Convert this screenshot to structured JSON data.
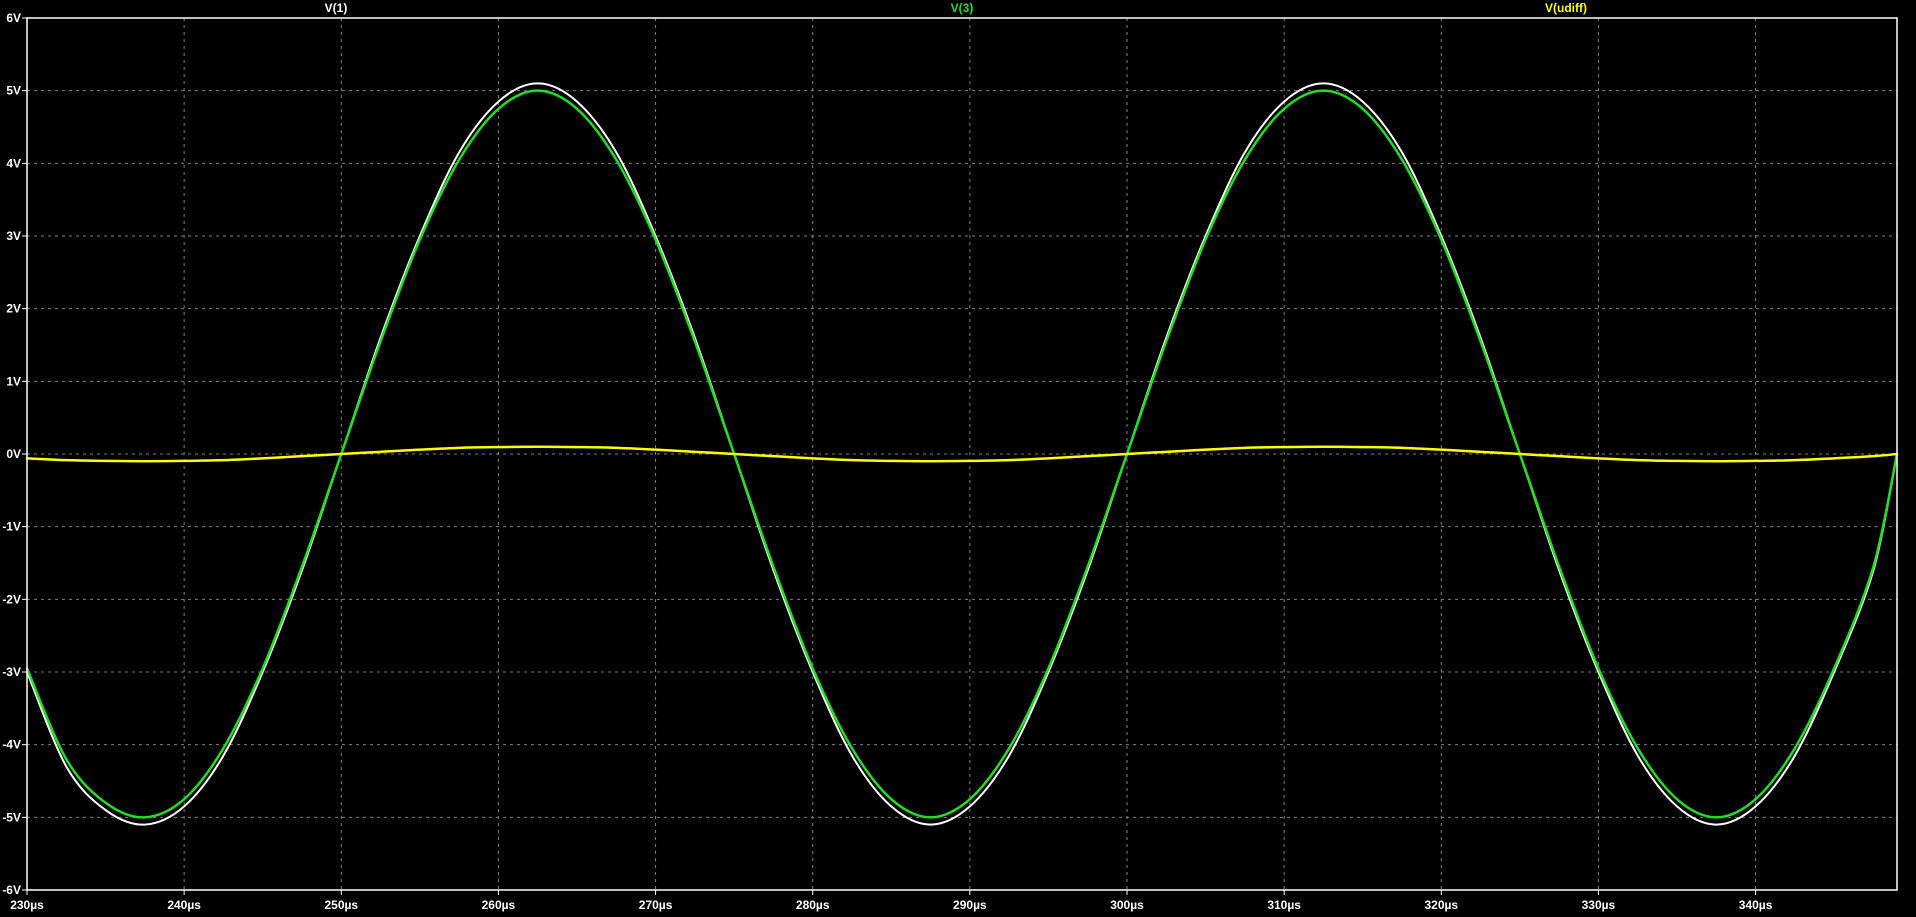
{
  "chart_data": {
    "type": "line",
    "title": "",
    "xlabel": "",
    "ylabel": "",
    "xlim": [
      230,
      349
    ],
    "ylim": [
      -6,
      6
    ],
    "x_unit": "µs",
    "y_unit": "V",
    "grid": true,
    "background": "#000000",
    "axis_color": "#ffffff",
    "grid_color": "#808080",
    "x_ticks": [
      "230µs",
      "240µs",
      "250µs",
      "260µs",
      "270µs",
      "280µs",
      "290µs",
      "300µs",
      "310µs",
      "320µs",
      "330µs",
      "340µs"
    ],
    "x_tick_values": [
      230,
      240,
      250,
      260,
      270,
      280,
      290,
      300,
      310,
      320,
      330,
      340
    ],
    "y_ticks": [
      "6V",
      "5V",
      "4V",
      "3V",
      "2V",
      "1V",
      "0V",
      "-1V",
      "-2V",
      "-3V",
      "-4V",
      "-5V",
      "-6V"
    ],
    "y_tick_values": [
      6,
      5,
      4,
      3,
      2,
      1,
      0,
      -1,
      -2,
      -3,
      -4,
      -5,
      -6
    ],
    "series": [
      {
        "name": "V(1)",
        "color": "#ffffff",
        "x": [
          230,
          232.5,
          235,
          237.5,
          240,
          242.5,
          245,
          247.5,
          250,
          252.5,
          255,
          257.5,
          260,
          262.5,
          265,
          267.5,
          270,
          272.5,
          275,
          277.5,
          280,
          282.5,
          285,
          287.5,
          290,
          292.5,
          295,
          297.5,
          300,
          302.5,
          305,
          307.5,
          310,
          312.5,
          315,
          317.5,
          320,
          322.5,
          325,
          327.5,
          330,
          332.5,
          335,
          337.5,
          340,
          342.5,
          345,
          347.5,
          349
        ],
        "y": [
          -3.0,
          -4.3,
          -4.9,
          -5.1,
          -4.85,
          -4.15,
          -3.0,
          -1.6,
          0.0,
          1.6,
          3.0,
          4.15,
          4.85,
          5.1,
          4.85,
          4.15,
          3.0,
          1.6,
          0.0,
          -1.6,
          -3.0,
          -4.15,
          -4.85,
          -5.1,
          -4.85,
          -4.15,
          -3.0,
          -1.6,
          0.0,
          1.6,
          3.0,
          4.15,
          4.85,
          5.1,
          4.85,
          4.15,
          3.0,
          1.6,
          0.0,
          -1.6,
          -3.0,
          -4.15,
          -4.85,
          -5.1,
          -4.85,
          -4.15,
          -3.0,
          -1.6,
          0.0
        ]
      },
      {
        "name": "V(3)",
        "color": "#22dd22",
        "x": [
          230,
          232.5,
          235,
          237.5,
          240,
          242.5,
          245,
          247.5,
          250,
          252.5,
          255,
          257.5,
          260,
          262.5,
          265,
          267.5,
          270,
          272.5,
          275,
          277.5,
          280,
          282.5,
          285,
          287.5,
          290,
          292.5,
          295,
          297.5,
          300,
          302.5,
          305,
          307.5,
          310,
          312.5,
          315,
          317.5,
          320,
          322.5,
          325,
          327.5,
          330,
          332.5,
          335,
          337.5,
          340,
          342.5,
          345,
          347.5,
          349
        ],
        "y": [
          -2.95,
          -4.2,
          -4.8,
          -5.0,
          -4.75,
          -4.05,
          -2.95,
          -1.55,
          0.0,
          1.55,
          2.95,
          4.05,
          4.75,
          5.0,
          4.75,
          4.05,
          2.95,
          1.55,
          0.0,
          -1.55,
          -2.95,
          -4.05,
          -4.75,
          -5.0,
          -4.75,
          -4.05,
          -2.95,
          -1.55,
          0.0,
          1.55,
          2.95,
          4.05,
          4.75,
          5.0,
          4.75,
          4.05,
          2.95,
          1.55,
          0.0,
          -1.55,
          -2.95,
          -4.05,
          -4.75,
          -5.0,
          -4.75,
          -4.05,
          -2.95,
          -1.55,
          0.0
        ]
      },
      {
        "name": "V(udiff)",
        "color": "#ffff00",
        "x": [
          230,
          232.5,
          235,
          237.5,
          240,
          242.5,
          245,
          247.5,
          250,
          252.5,
          255,
          257.5,
          260,
          262.5,
          265,
          267.5,
          270,
          272.5,
          275,
          277.5,
          280,
          282.5,
          285,
          287.5,
          290,
          292.5,
          295,
          297.5,
          300,
          302.5,
          305,
          307.5,
          310,
          312.5,
          315,
          317.5,
          320,
          322.5,
          325,
          327.5,
          330,
          332.5,
          335,
          337.5,
          340,
          342.5,
          345,
          347.5,
          349
        ],
        "y": [
          -0.06,
          -0.085,
          -0.095,
          -0.1,
          -0.095,
          -0.085,
          -0.06,
          -0.03,
          0.0,
          0.03,
          0.06,
          0.085,
          0.095,
          0.1,
          0.095,
          0.085,
          0.06,
          0.03,
          0.0,
          -0.03,
          -0.06,
          -0.085,
          -0.095,
          -0.1,
          -0.095,
          -0.085,
          -0.06,
          -0.03,
          0.0,
          0.03,
          0.06,
          0.085,
          0.095,
          0.1,
          0.095,
          0.085,
          0.06,
          0.03,
          0.0,
          -0.03,
          -0.06,
          -0.085,
          -0.095,
          -0.1,
          -0.095,
          -0.085,
          -0.06,
          -0.03,
          0.0
        ]
      }
    ]
  }
}
